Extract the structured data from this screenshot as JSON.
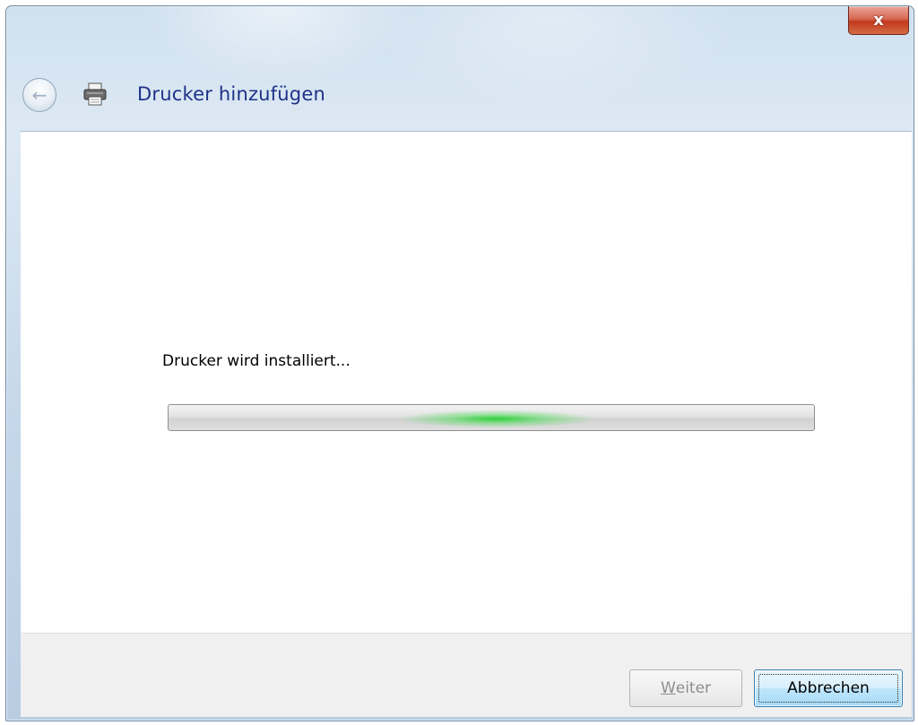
{
  "window": {
    "close_label": "x"
  },
  "header": {
    "title": "Drucker hinzufügen",
    "back_icon": "back-arrow-icon",
    "app_icon": "printer-icon"
  },
  "main": {
    "status_text": "Drucker wird installiert...",
    "progress": {
      "state": "indeterminate",
      "accent_color": "#2fd03a"
    }
  },
  "footer": {
    "next_button": {
      "accel": "W",
      "rest": "eiter",
      "enabled": false
    },
    "cancel_button": {
      "label": "Abbrechen",
      "focused": true
    }
  }
}
